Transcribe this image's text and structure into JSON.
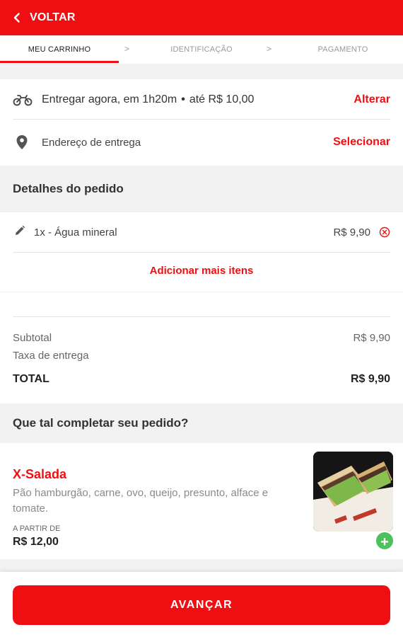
{
  "header": {
    "back_label": "VOLTAR"
  },
  "steps": [
    {
      "label": "MEU CARRINHO"
    },
    {
      "label": "IDENTIFICAÇÃO"
    },
    {
      "label": "PAGAMENTO"
    }
  ],
  "step_separator": ">",
  "delivery": {
    "time_text": "Entregar agora, em 1h20m",
    "dot": "•",
    "fee_text": "até R$ 10,00",
    "change_label": "Alterar",
    "address_text": "Endereço de entrega",
    "select_label": "Selecionar"
  },
  "order": {
    "section_title": "Detalhes do pedido",
    "items": [
      {
        "name": "1x - Água mineral",
        "price": "R$ 9,90"
      }
    ],
    "add_more_label": "Adicionar mais itens"
  },
  "summary": {
    "subtotal_label": "Subtotal",
    "subtotal_value": "R$ 9,90",
    "delivery_fee_label": "Taxa de entrega",
    "total_label": "TOTAL",
    "total_value": "R$ 9,90"
  },
  "upsell": {
    "section_title": "Que tal completar seu pedido?",
    "product": {
      "name": "X-Salada",
      "description": "Pão hamburgão, carne, ovo, queijo, presunto, alface e tomate.",
      "from_label": "A PARTIR DE",
      "price": "R$ 12,00",
      "add_symbol": "+"
    }
  },
  "footer": {
    "advance_label": "AVANÇAR"
  },
  "colors": {
    "brand_red": "#ef0f13",
    "add_green": "#4cc25c"
  },
  "icons": {
    "back": "chevron-left-icon",
    "delivery": "motorcycle-icon",
    "address": "location-pin-icon",
    "edit": "pencil-icon",
    "remove": "close-circle-icon",
    "add": "plus-icon"
  }
}
